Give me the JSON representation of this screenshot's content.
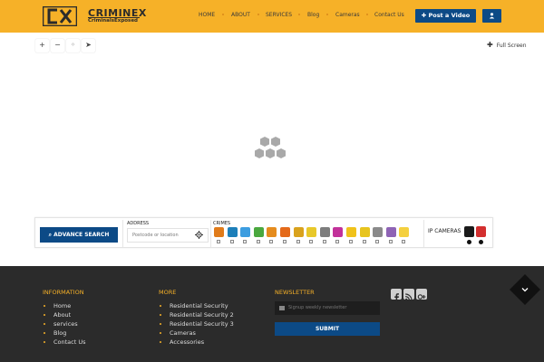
{
  "header": {
    "logo_name": "CRIMINEX",
    "logo_tagline": "CriminalsExposed",
    "nav": [
      {
        "label": "HOME"
      },
      {
        "label": "ABOUT"
      },
      {
        "label": "SERVICES"
      },
      {
        "label": "Blog"
      },
      {
        "label": "Cameras"
      },
      {
        "label": "Contact Us"
      }
    ],
    "post_video_label": "✚ Post a Video",
    "user_icon": "user-icon"
  },
  "map": {
    "controls": [
      "+",
      "−",
      "◦",
      "➤"
    ],
    "control_icons": [
      "zoom-in-icon",
      "zoom-out-icon",
      "locate-icon",
      "navigate-icon"
    ],
    "fullscreen_label": "Full Screen"
  },
  "search": {
    "advance_label": "ADVANCE SEARCH",
    "address_label": "ADDRESS",
    "address_placeholder": "Postcode or location",
    "crimes_label": "CRIMES",
    "crime_colors": [
      "#e07b1a",
      "#1d7fb9",
      "#3c9de0",
      "#4aa83f",
      "#e58c1e",
      "#e46a1a",
      "#d9a21d",
      "#e8c82a",
      "#7d7d7d",
      "#c2319a",
      "#f0c21a",
      "#e7c41e",
      "#8a8a8a",
      "#8e63b5",
      "#f4d03f"
    ],
    "ip_cameras_label": "IP CAMERAS",
    "camera_colors": [
      "#1a1a1a",
      "#d32f2f"
    ]
  },
  "footer": {
    "information_title": "INFORMATION",
    "information_links": [
      "Home",
      "About",
      "services",
      "Blog",
      "Contact Us"
    ],
    "more_title": "MORE",
    "more_links": [
      "Residential Security",
      "Residential Security 2",
      "Residential Security 3",
      "Cameras",
      "Accessories"
    ],
    "newsletter_title": "NEWSLETTER",
    "newsletter_placeholder": "Signup weekly newsletter",
    "submit_label": "SUBMIT",
    "social_icons": [
      "facebook-icon",
      "rss-icon",
      "google-plus-icon"
    ]
  },
  "colors": {
    "brand_yellow": "#f6b128",
    "brand_blue": "#0c4a86",
    "footer_bg": "#2b2b2b"
  }
}
